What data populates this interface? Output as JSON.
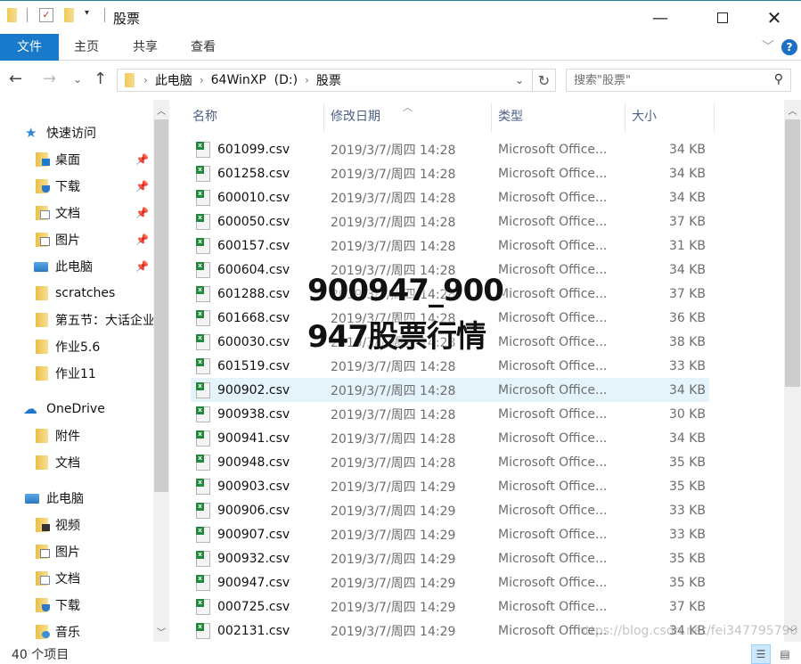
{
  "window": {
    "title": "股票",
    "minimize_icon": "minimize-icon",
    "maximize_icon": "maximize-icon",
    "close_icon": "close-icon"
  },
  "ribbon": {
    "tabs": [
      {
        "label": "文件",
        "active": true
      },
      {
        "label": "主页"
      },
      {
        "label": "共享"
      },
      {
        "label": "查看"
      }
    ],
    "help": "?"
  },
  "address": {
    "breadcrumb": [
      "此电脑",
      "64WinXP  (D:)",
      "股票"
    ],
    "search_placeholder": "搜索\"股票\""
  },
  "nav": {
    "items": [
      {
        "label": "快速访问",
        "icon": "star-icon",
        "level": 0
      },
      {
        "label": "桌面",
        "icon": "desktop-folder-icon",
        "pinned": true,
        "level": 1
      },
      {
        "label": "下载",
        "icon": "downloads-folder-icon",
        "pinned": true,
        "level": 1
      },
      {
        "label": "文档",
        "icon": "documents-folder-icon",
        "pinned": true,
        "level": 1
      },
      {
        "label": "图片",
        "icon": "pictures-folder-icon",
        "pinned": true,
        "level": 1
      },
      {
        "label": "此电脑",
        "icon": "computer-icon",
        "pinned": true,
        "level": 1
      },
      {
        "label": "scratches",
        "icon": "folder-icon",
        "level": 1
      },
      {
        "label": "第五节：大话企业",
        "icon": "folder-icon",
        "level": 1
      },
      {
        "label": "作业5.6",
        "icon": "folder-icon",
        "level": 1
      },
      {
        "label": "作业11",
        "icon": "folder-icon",
        "level": 1
      },
      {
        "label": "OneDrive",
        "icon": "cloud-icon",
        "level": 0
      },
      {
        "label": "附件",
        "icon": "folder-icon",
        "level": 1
      },
      {
        "label": "文档",
        "icon": "folder-icon",
        "level": 1
      },
      {
        "label": "此电脑",
        "icon": "computer-icon",
        "level": 0
      },
      {
        "label": "视频",
        "icon": "videos-folder-icon",
        "level": 1
      },
      {
        "label": "图片",
        "icon": "pictures-folder-icon",
        "level": 1
      },
      {
        "label": "文档",
        "icon": "documents-folder-icon",
        "level": 1
      },
      {
        "label": "下载",
        "icon": "downloads-folder-icon",
        "level": 1
      },
      {
        "label": "音乐",
        "icon": "music-folder-icon",
        "level": 1
      }
    ]
  },
  "columns": {
    "name": "名称",
    "date": "修改日期",
    "type": "类型",
    "size": "大小",
    "sort_indicator": "^"
  },
  "files": [
    {
      "name": "601099.csv",
      "date": "2019/3/7/周四 14:28",
      "type": "Microsoft Office...",
      "size": "34 KB"
    },
    {
      "name": "601258.csv",
      "date": "2019/3/7/周四 14:28",
      "type": "Microsoft Office...",
      "size": "34 KB"
    },
    {
      "name": "600010.csv",
      "date": "2019/3/7/周四 14:28",
      "type": "Microsoft Office...",
      "size": "34 KB"
    },
    {
      "name": "600050.csv",
      "date": "2019/3/7/周四 14:28",
      "type": "Microsoft Office...",
      "size": "37 KB"
    },
    {
      "name": "600157.csv",
      "date": "2019/3/7/周四 14:28",
      "type": "Microsoft Office...",
      "size": "31 KB"
    },
    {
      "name": "600604.csv",
      "date": "2019/3/7/周四 14:28",
      "type": "Microsoft Office...",
      "size": "34 KB"
    },
    {
      "name": "601288.csv",
      "date": "2019/3/7/周四 14:28",
      "type": "Microsoft Office...",
      "size": "37 KB"
    },
    {
      "name": "601668.csv",
      "date": "2019/3/7/周四 14:28",
      "type": "Microsoft Office...",
      "size": "36 KB"
    },
    {
      "name": "600030.csv",
      "date": "2019/3/7/周四 14:28",
      "type": "Microsoft Office...",
      "size": "38 KB"
    },
    {
      "name": "601519.csv",
      "date": "2019/3/7/周四 14:28",
      "type": "Microsoft Office...",
      "size": "33 KB"
    },
    {
      "name": "900902.csv",
      "date": "2019/3/7/周四 14:28",
      "type": "Microsoft Office...",
      "size": "34 KB",
      "selected": true
    },
    {
      "name": "900938.csv",
      "date": "2019/3/7/周四 14:28",
      "type": "Microsoft Office...",
      "size": "30 KB"
    },
    {
      "name": "900941.csv",
      "date": "2019/3/7/周四 14:28",
      "type": "Microsoft Office...",
      "size": "34 KB"
    },
    {
      "name": "900948.csv",
      "date": "2019/3/7/周四 14:28",
      "type": "Microsoft Office...",
      "size": "35 KB"
    },
    {
      "name": "900903.csv",
      "date": "2019/3/7/周四 14:29",
      "type": "Microsoft Office...",
      "size": "35 KB"
    },
    {
      "name": "900906.csv",
      "date": "2019/3/7/周四 14:29",
      "type": "Microsoft Office...",
      "size": "33 KB"
    },
    {
      "name": "900907.csv",
      "date": "2019/3/7/周四 14:29",
      "type": "Microsoft Office...",
      "size": "33 KB"
    },
    {
      "name": "900932.csv",
      "date": "2019/3/7/周四 14:29",
      "type": "Microsoft Office...",
      "size": "35 KB"
    },
    {
      "name": "900947.csv",
      "date": "2019/3/7/周四 14:29",
      "type": "Microsoft Office...",
      "size": "35 KB"
    },
    {
      "name": "000725.csv",
      "date": "2019/3/7/周四 14:29",
      "type": "Microsoft Office...",
      "size": "37 KB"
    },
    {
      "name": "002131.csv",
      "date": "2019/3/7/周四 14:29",
      "type": "Microsoft Office...",
      "size": "34 KB"
    }
  ],
  "status": {
    "item_count": "40 个项目"
  },
  "overlay": {
    "line1": "900947_900",
    "line2": "947股票行情"
  },
  "watermark": "https://blog.csdn.net/fei347795790"
}
